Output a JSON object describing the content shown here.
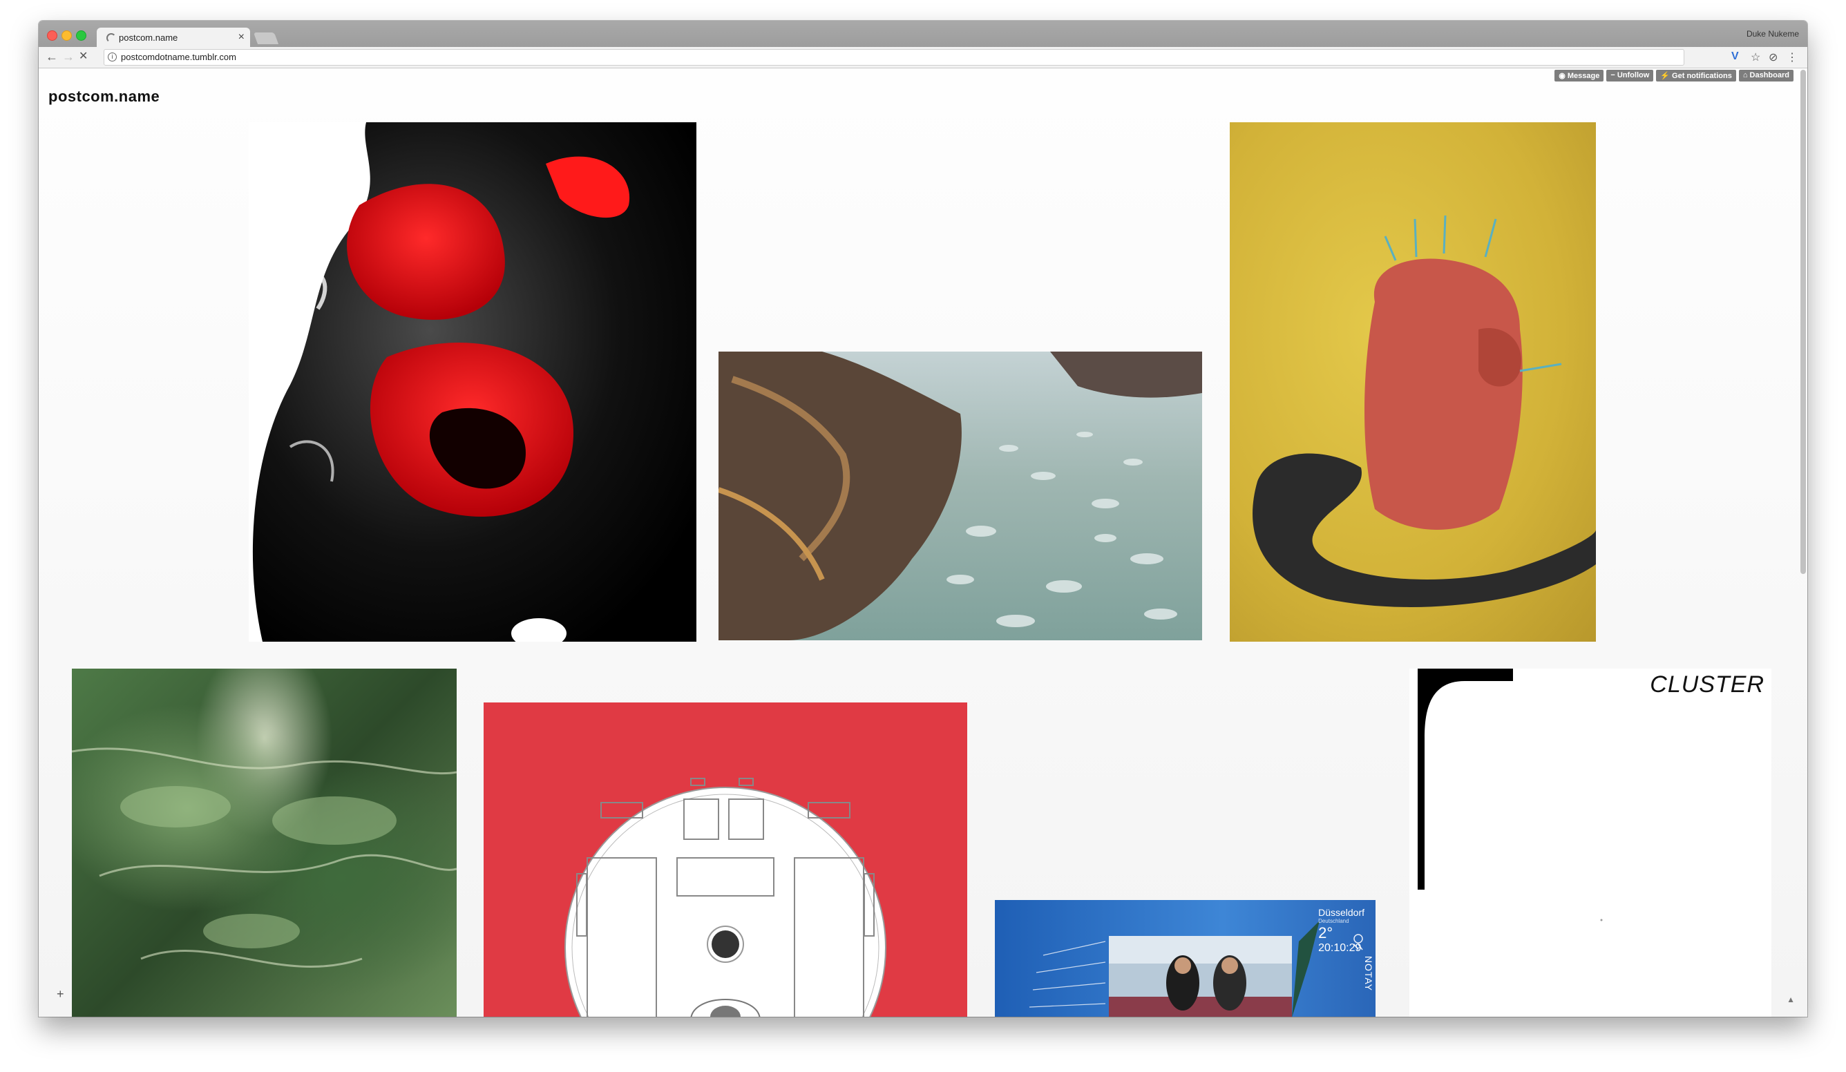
{
  "browser": {
    "tab": {
      "title": "postcom.name",
      "close": "×"
    },
    "profile_name": "Duke Nukeme",
    "nav": {
      "back": "←",
      "forward": "→",
      "stop": "✕"
    },
    "address": "postcomdotname.tumblr.com",
    "info_glyph": "i",
    "extensions": {
      "v": "V",
      "star": "☆",
      "sync": "⊘",
      "menu": "⋮"
    }
  },
  "tumblr_controls": [
    {
      "icon": "message-icon",
      "label": "Message"
    },
    {
      "icon": "unfollow-icon",
      "label": "Unfollow"
    },
    {
      "icon": "lightning-icon",
      "label": "Get notifications"
    },
    {
      "icon": "home-icon",
      "label": "Dashboard"
    }
  ],
  "blog": {
    "title": "postcom.name"
  },
  "posts": [
    {
      "id": "p1",
      "subject": "glossy-black-red-sculpture"
    },
    {
      "id": "p2",
      "subject": "rocky-icescape"
    },
    {
      "id": "p3",
      "subject": "red-figure-with-snake-on-yellow"
    },
    {
      "id": "p4",
      "subject": "green-marble-texture"
    },
    {
      "id": "p5",
      "subject": "red-with-white-disc"
    },
    {
      "id": "p6",
      "subject": "weather-news-screen"
    },
    {
      "id": "p7",
      "subject": "cluster-poster",
      "label": "CLUSTER"
    }
  ],
  "weather": {
    "city": "Düsseldorf",
    "region": "Deutschland",
    "temp": "2°",
    "time": "20:10:29",
    "side_text": "NOTAY"
  },
  "floating": {
    "plus": "+",
    "up": "▲"
  },
  "colors": {
    "tumblr_btn": "#7d7d7d",
    "post5_red": "#e03a44",
    "post3_yellow": "#d2b238"
  }
}
